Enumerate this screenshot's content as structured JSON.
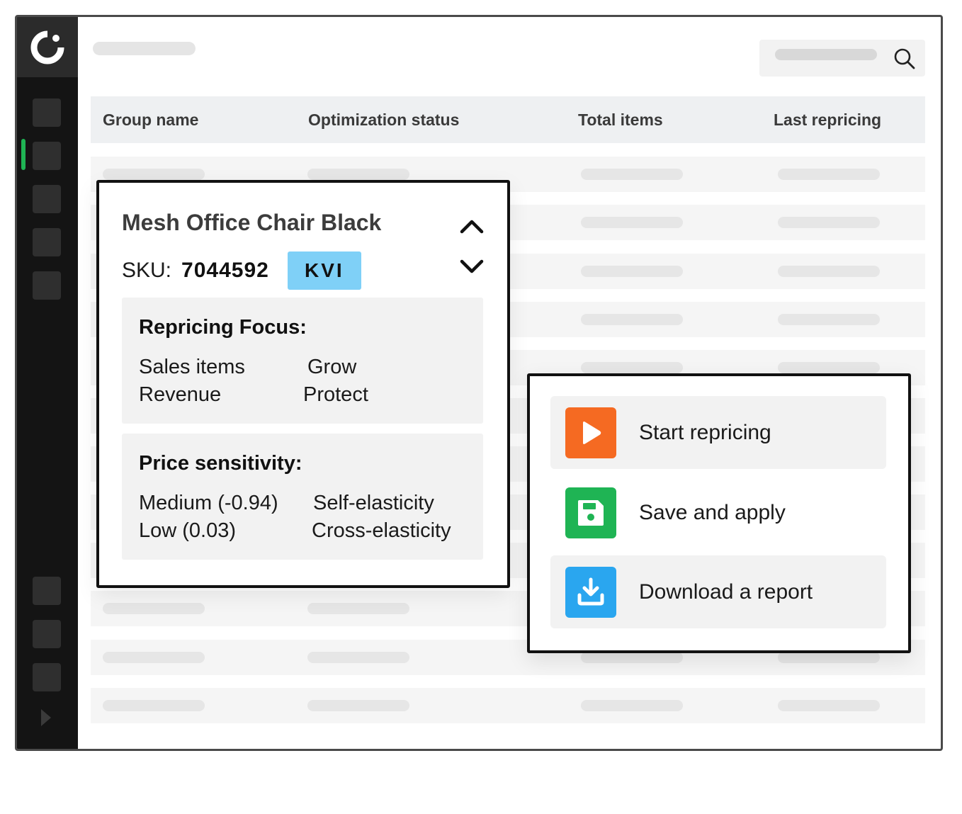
{
  "table": {
    "headers": [
      "Group name",
      "Optimization status",
      "Total items",
      "Last repricing"
    ]
  },
  "product": {
    "name": "Mesh Office Chair Black",
    "sku_label": "SKU:",
    "sku": "7044592",
    "badge": "KVI",
    "repricing": {
      "title": "Repricing Focus:",
      "rows": [
        {
          "metric": "Sales items",
          "goal": "Grow"
        },
        {
          "metric": "Revenue",
          "goal": "Protect"
        }
      ]
    },
    "sensitivity": {
      "title": "Price sensitivity:",
      "rows": [
        {
          "value": "Medium (-0.94)",
          "type": "Self-elasticity"
        },
        {
          "value": "Low (0.03)",
          "type": "Cross-elasticity"
        }
      ]
    }
  },
  "actions": [
    {
      "label": "Start repricing",
      "icon": "play-icon",
      "color": "#f56a22"
    },
    {
      "label": "Save and apply",
      "icon": "save-icon",
      "color": "#1fb454"
    },
    {
      "label": "Download a report",
      "icon": "download-icon",
      "color": "#2aa6ef"
    }
  ],
  "colors": {
    "sidebar": "#141414",
    "accent": "#1fb454",
    "badge": "#7fd0f7"
  }
}
